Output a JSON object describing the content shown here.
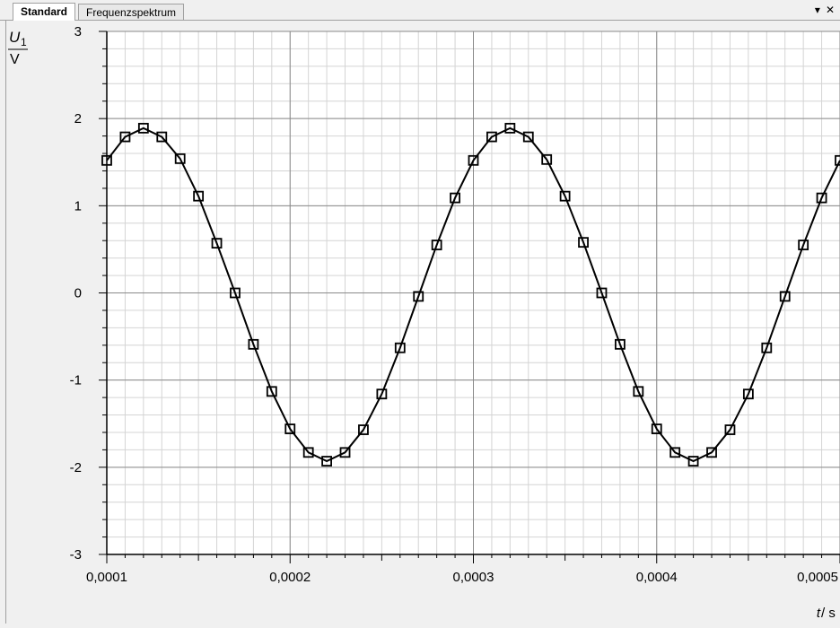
{
  "tabs": [
    {
      "label": "Standard",
      "active": true
    },
    {
      "label": "Frequenzspektrum",
      "active": false
    }
  ],
  "window_controls": {
    "dropdown_icon": "chevron-down-icon",
    "close_icon": "close-icon"
  },
  "chart_data": {
    "type": "line",
    "title": "",
    "ylabel_numerator": "U",
    "ylabel_subscript": "1",
    "ylabel_denominator": "V",
    "xlabel_italic": "t",
    "xlabel_unit": " / s",
    "xlim": [
      0.0001,
      0.0005
    ],
    "ylim": [
      -3,
      3
    ],
    "x_ticks": [
      0.0001,
      0.0002,
      0.0003,
      0.0004,
      0.0005
    ],
    "x_tick_labels": [
      "0,0001",
      "0,0002",
      "0,0003",
      "0,0004",
      "0,0005"
    ],
    "y_ticks": [
      -3,
      -2,
      -1,
      0,
      1,
      2,
      3
    ],
    "y_tick_labels": [
      "-3",
      "-2",
      "-1",
      "0",
      "1",
      "2",
      "3"
    ],
    "grid": true,
    "marker": "square",
    "series": [
      {
        "x": [
          0.0001,
          0.00011,
          0.00012,
          0.00013,
          0.00014,
          0.00015,
          0.00016,
          0.00017,
          0.00018,
          0.00019,
          0.0002,
          0.00021,
          0.00022,
          0.00023,
          0.00024,
          0.00025,
          0.00026,
          0.00027,
          0.00028,
          0.00029,
          0.0003,
          0.00031,
          0.00032,
          0.00033,
          0.00034,
          0.00035,
          0.00036,
          0.00037,
          0.00038,
          0.00039,
          0.0004,
          0.00041,
          0.00042,
          0.00043,
          0.00044,
          0.00045,
          0.00046,
          0.00047,
          0.00048,
          0.00049,
          0.0005
        ],
        "y": [
          1.52,
          1.79,
          1.89,
          1.79,
          1.54,
          1.11,
          0.57,
          0,
          -0.59,
          -1.13,
          -1.56,
          -1.83,
          -1.93,
          -1.83,
          -1.57,
          -1.16,
          -0.63,
          -0.04,
          0.55,
          1.09,
          1.52,
          1.79,
          1.89,
          1.79,
          1.53,
          1.11,
          0.58,
          0,
          -0.59,
          -1.13,
          -1.56,
          -1.83,
          -1.93,
          -1.83,
          -1.57,
          -1.16,
          -0.63,
          -0.04,
          0.55,
          1.09,
          1.52
        ]
      }
    ]
  }
}
